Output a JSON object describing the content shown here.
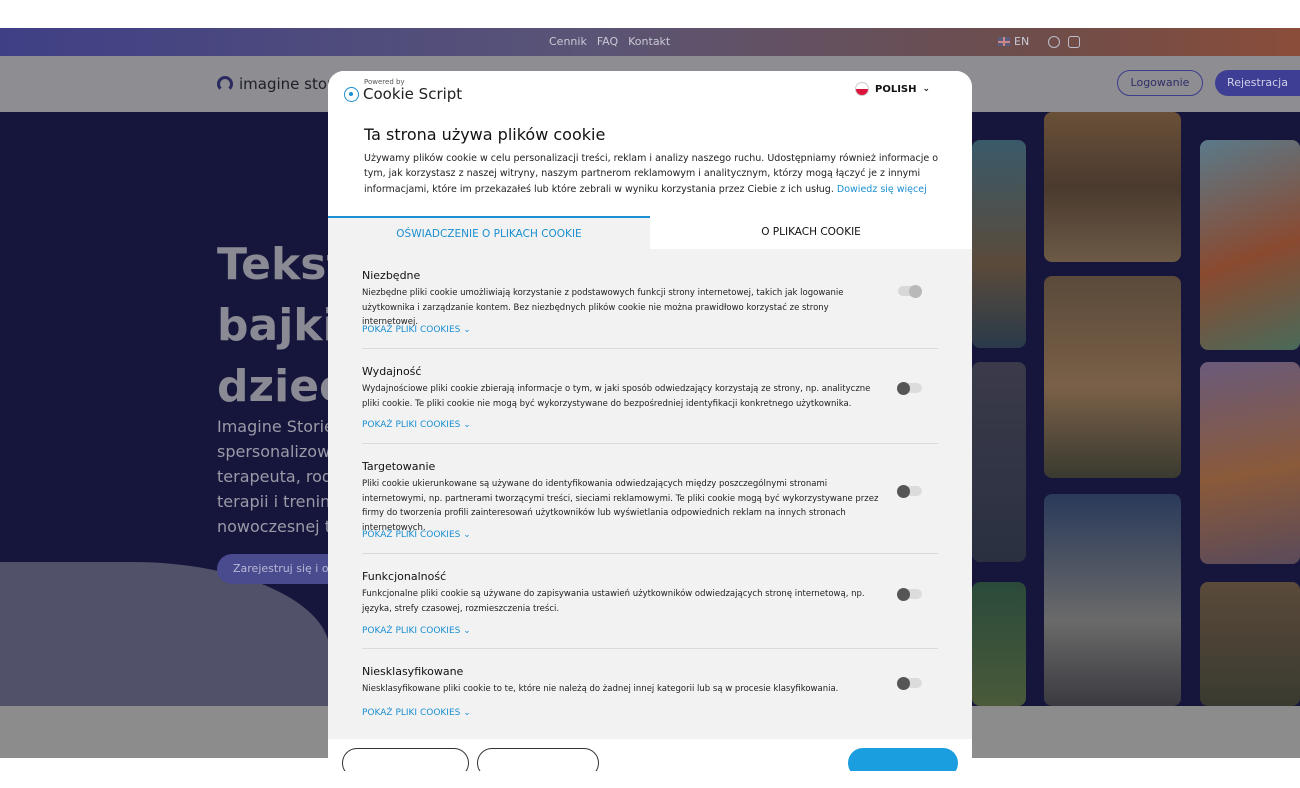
{
  "top_bar": {
    "links": [
      "Cennik",
      "FAQ",
      "Kontakt"
    ],
    "language": "EN",
    "social": [
      "facebook-icon",
      "instagram-icon"
    ]
  },
  "header": {
    "logo_text": "imagine stor",
    "login_label": "Logowanie",
    "register_label": "Rejestracja"
  },
  "hero": {
    "title_lines": "Tekst\nbajki\ndziec",
    "text_lines": "Imagine Stories\nspersonalizowa\nterapeuta, rodz\nterapii i trening\nnowoczesnej te",
    "cta_label": "Zarejestruj się i odb"
  },
  "cookie_dialog": {
    "powered_by": "Powered by",
    "brand": "Cookie Script",
    "language_label": "POLISH",
    "title": "Ta strona używa plików cookie",
    "description": "Używamy plików cookie w celu personalizacji treści, reklam i analizy naszego ruchu. Udostępniamy również informacje o tym, jak korzystasz z naszej witryny, naszym partnerom reklamowym i analitycznym, którzy mogą łączyć je z innymi informacjami, które im przekazałeś lub które zebrali w wyniku korzystania przez Ciebie z ich usług.",
    "learn_more": "Dowiedz się więcej",
    "tabs": [
      "OŚWIADCZENIE O PLIKACH COOKIE",
      "O PLIKACH COOKIE"
    ],
    "show_cookies_label": "POKAŻ PLIKI COOKIES",
    "categories": [
      {
        "title": "Niezbędne",
        "description": "Niezbędne pliki cookie umożliwiają korzystanie z podstawowych funkcji strony internetowej, takich jak logowanie użytkownika i zarządzanie kontem. Bez niezbędnych plików cookie nie można prawidłowo korzystać ze strony internetowej.",
        "enabled": true
      },
      {
        "title": "Wydajność",
        "description": "Wydajnościowe pliki cookie zbierają informacje o tym, w jaki sposób odwiedzający korzystają ze strony, np. analityczne pliki cookie. Te pliki cookie nie mogą być wykorzystywane do bezpośredniej identyfikacji konkretnego użytkownika.",
        "enabled": false
      },
      {
        "title": "Targetowanie",
        "description": "Pliki cookie ukierunkowane są używane do identyfikowania odwiedzających między poszczególnymi stronami internetowymi, np. partnerami tworzącymi treści, sieciami reklamowymi. Te pliki cookie mogą być wykorzystywane przez firmy do tworzenia profili zainteresowań użytkowników lub wyświetlania odpowiednich reklam na innych stronach internetowych.",
        "enabled": false
      },
      {
        "title": "Funkcjonalność",
        "description": "Funkcjonalne pliki cookie są używane do zapisywania ustawień użytkowników odwiedzających stronę internetową, np. języka, strefy czasowej, rozmieszczenia treści.",
        "enabled": false
      },
      {
        "title": "Niesklasyfikowane",
        "description": "Niesklasyfikowane pliki cookie to te, które nie należą do żadnej innej kategorii lub są w procesie klasyfikowania.",
        "enabled": false
      }
    ]
  },
  "colors": {
    "accent": "#1b8fd1",
    "hero_bg": "#16163c",
    "brand_button": "#3e3e94"
  }
}
